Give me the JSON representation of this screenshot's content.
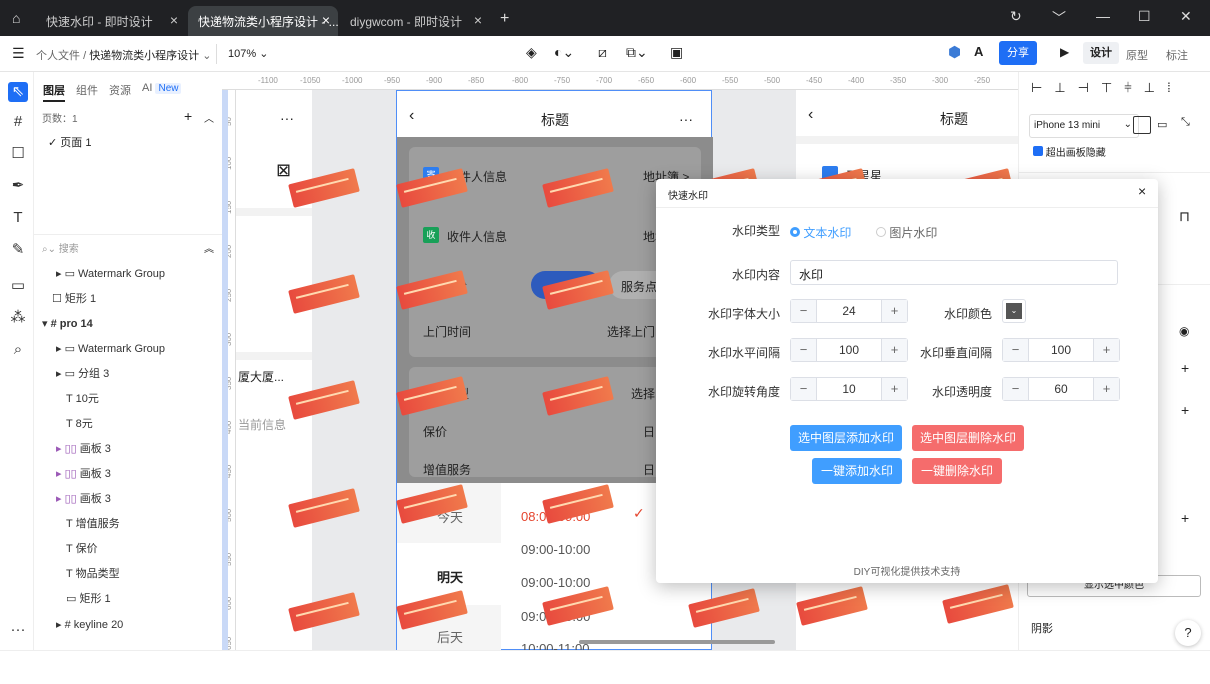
{
  "tabs": [
    {
      "label": "快速水印 - 即时设计"
    },
    {
      "label": "快递物流类小程序设计 - ..."
    },
    {
      "label": "diygwcom - 即时设计"
    }
  ],
  "toolbar": {
    "breadcrumb_root": "个人文件",
    "breadcrumb_sep": "/",
    "breadcrumb_file": "快递物流类小程序设计",
    "zoom": "107%",
    "share_label": "分享",
    "mode_design": "设计",
    "mode_prototype": "原型",
    "mode_annotate": "标注"
  },
  "layers": {
    "tab_layers": "图层",
    "tab_components": "组件",
    "tab_assets": "资源",
    "tab_ai": "AI",
    "badge_new": "New",
    "page_count": "页数：1",
    "page_name": "页面 1",
    "search_placeholder": "搜索",
    "items": [
      {
        "label": "Watermark Group"
      },
      {
        "label": "矩形 1"
      },
      {
        "label": "pro 14"
      },
      {
        "label": "Watermark Group"
      },
      {
        "label": "分组 3"
      },
      {
        "label": "10元"
      },
      {
        "label": "8元"
      },
      {
        "label": "画板 3"
      },
      {
        "label": "画板 3"
      },
      {
        "label": "画板 3"
      },
      {
        "label": "增值服务"
      },
      {
        "label": "保价"
      },
      {
        "label": "物品类型"
      },
      {
        "label": "矩形 1"
      },
      {
        "label": "keyline 20"
      }
    ]
  },
  "ruler": {
    "top": [
      "-1100",
      "-1050",
      "-1000",
      "-950",
      "-900",
      "-850",
      "-800",
      "-750",
      "-700",
      "-650",
      "-600",
      "-550",
      "-500",
      "-450",
      "-400",
      "-350",
      "-300",
      "-250"
    ],
    "left": [
      "50",
      "100",
      "150",
      "200",
      "250",
      "300",
      "350",
      "400",
      "450",
      "500",
      "550",
      "600",
      "650"
    ]
  },
  "canvas": {
    "left_frame": {
      "title_partial": "厦大厦...",
      "info_partial": "当前信息"
    },
    "mid": {
      "title": "标题",
      "more": "···",
      "sender": "寄件人信息",
      "sender_badge": "寄",
      "address_book": "地址簿 >",
      "receiver": "收件人信息",
      "receiver_badge": "收",
      "address_partial": "地址",
      "method_partial": "式",
      "service_point": "服务点",
      "pickup_time": "上门时间",
      "pickup_select": "选择上门时",
      "item_type_partial": "型",
      "select_partial": "选择",
      "insurance": "保价",
      "insurance_val": "日",
      "value_added": "增值服务",
      "value_added_val": "日",
      "days": [
        "今天",
        "明天",
        "后天"
      ],
      "slots": [
        "08:00-09:00",
        "09:00-10:00",
        "09:00-10:00",
        "09:00-10:00",
        "10:00-11:00"
      ]
    },
    "right_frame": {
      "title": "标题",
      "sender_partial": "王星星"
    }
  },
  "right_panel": {
    "device": "iPhone 13 mini",
    "clip_label": "超出画板隐藏",
    "shadow_label": "阴影",
    "select_color_label": "显示选中颜色",
    "help": "?"
  },
  "modal": {
    "title": "快速水印",
    "type_label": "水印类型",
    "type_text": "文本水印",
    "type_image": "图片水印",
    "content_label": "水印内容",
    "content_value": "水印",
    "font_size_label": "水印字体大小",
    "font_size": "24",
    "color_label": "水印颜色",
    "hgap_label": "水印水平间隔",
    "hgap": "100",
    "vgap_label": "水印垂直间隔",
    "vgap": "100",
    "rotate_label": "水印旋转角度",
    "rotate": "10",
    "opacity_label": "水印透明度",
    "opacity": "60",
    "btn_add_selected": "选中图层添加水印",
    "btn_del_selected": "选中图层删除水印",
    "btn_add_all": "一键添加水印",
    "btn_del_all": "一键删除水印",
    "footer": "DIY可视化提供技术支持"
  },
  "colors": {
    "primary": "#409eff",
    "danger": "#f56c6c",
    "brand": "#1e6ef5",
    "watermark": "#e84a3e"
  }
}
